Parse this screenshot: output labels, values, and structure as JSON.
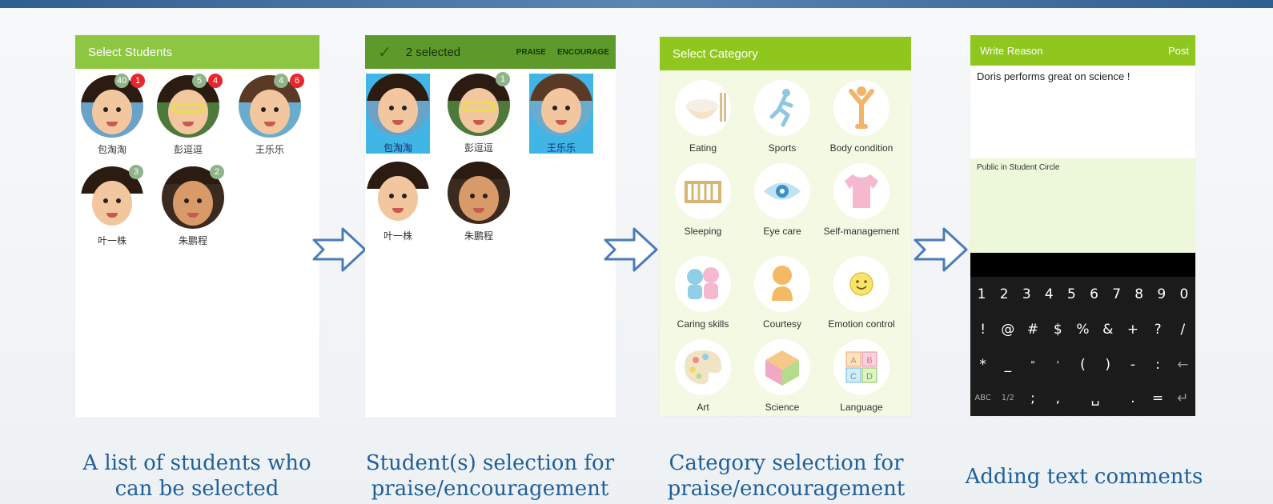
{
  "screen1": {
    "title": "Select Students",
    "students": [
      {
        "name": "包淘淘",
        "badge_green": "40",
        "badge_red": "1"
      },
      {
        "name": "彭逗逗",
        "badge_green": "5",
        "badge_red": "4"
      },
      {
        "name": "王乐乐",
        "badge_green": "4",
        "badge_red": "6"
      },
      {
        "name": "叶一株",
        "badge_green": "3"
      },
      {
        "name": "朱鹏程",
        "badge_green": "2"
      }
    ]
  },
  "screen2": {
    "selected_count": "2 selected",
    "praise_label": "PRAISE",
    "encourage_label": "ENCOURAGE",
    "students": [
      {
        "name": "包淘淘",
        "selected": true
      },
      {
        "name": "彭逗逗",
        "selected": false,
        "badge_green": "1"
      },
      {
        "name": "王乐乐",
        "selected": true
      },
      {
        "name": "叶一株",
        "selected": false
      },
      {
        "name": "朱鹏程",
        "selected": false
      }
    ]
  },
  "screen3": {
    "title": "Select Category",
    "categories": [
      {
        "label": "Eating",
        "icon": "rice-bowl-icon"
      },
      {
        "label": "Sports",
        "icon": "running-person-icon"
      },
      {
        "label": "Body condition",
        "icon": "body-icon"
      },
      {
        "label": "Sleeping",
        "icon": "crib-icon"
      },
      {
        "label": "Eye care",
        "icon": "eye-icon"
      },
      {
        "label": "Self-management",
        "icon": "shirt-icon"
      },
      {
        "label": "Caring skills",
        "icon": "two-kids-icon"
      },
      {
        "label": "Courtesy",
        "icon": "person-icon"
      },
      {
        "label": "Emotion control",
        "icon": "smiley-icon"
      },
      {
        "label": "Art",
        "icon": "palette-icon"
      },
      {
        "label": "Science",
        "icon": "cube-icon"
      },
      {
        "label": "Language",
        "icon": "letter-blocks-icon"
      }
    ]
  },
  "screen4": {
    "title": "Write Reason",
    "post_label": "Post",
    "reason_text": "Doris performs great on science !",
    "public_label": "Public in Student Circle",
    "keyboard": {
      "row1": [
        "1",
        "2",
        "3",
        "4",
        "5",
        "6",
        "7",
        "8",
        "9",
        "0"
      ],
      "row2": [
        "!",
        "@",
        "#",
        "$",
        "%",
        "&",
        "+",
        "?",
        "/"
      ],
      "row3": [
        "*",
        "_",
        "\"",
        "'",
        "(",
        ")",
        "-",
        ":",
        "←"
      ],
      "row4": [
        "ABC",
        "1/2",
        ";",
        ",",
        "␣",
        ".",
        "=",
        "↵"
      ]
    }
  },
  "captions": {
    "c1": "A list of students who can be selected",
    "c2": "Student(s) selection for praise/encouragement",
    "c3": "Category selection for praise/encouragement",
    "c4": "Adding text comments"
  },
  "colors": {
    "accent_green": "#8dc641",
    "selected_blue": "#40b5e6",
    "caption_blue": "#1f5f9a"
  }
}
